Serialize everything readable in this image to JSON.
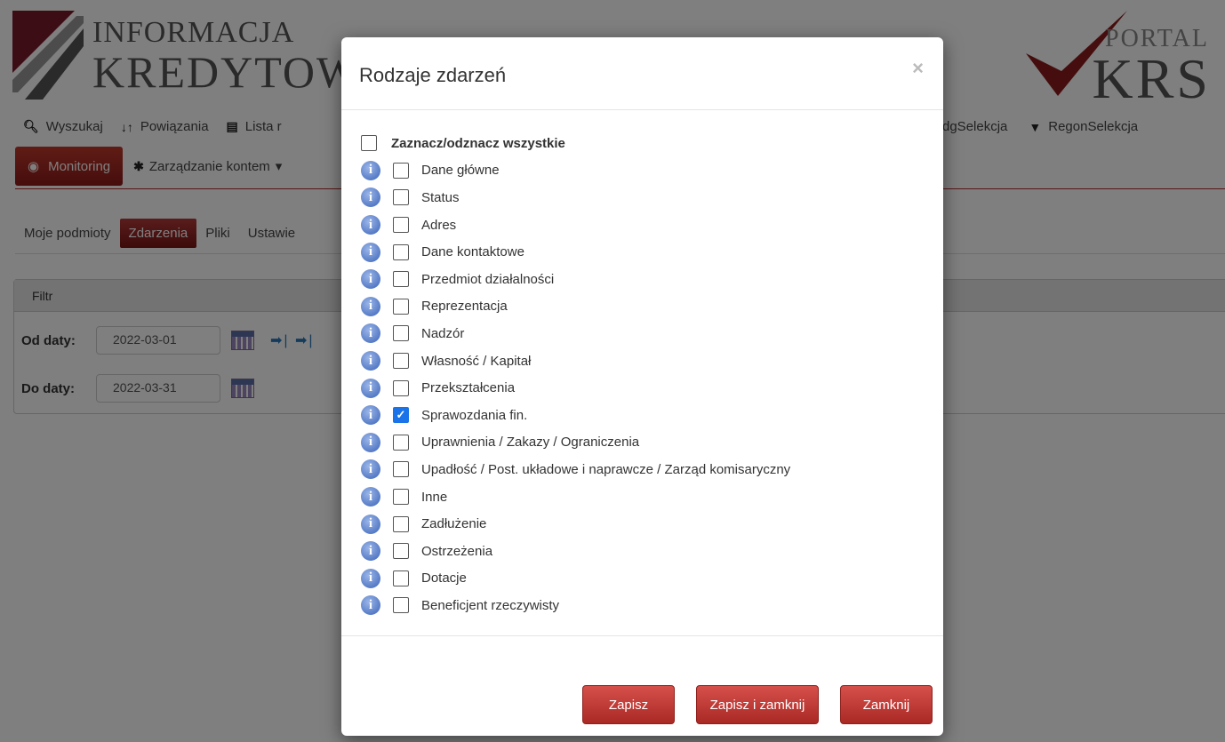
{
  "logo_left": {
    "line1": "INFORMACJA",
    "line2": "KREDYTOWA"
  },
  "logo_right": {
    "line1": "PORTAL",
    "line2": "KRS"
  },
  "nav": {
    "search": "Wyszukaj",
    "relations": "Powiązania",
    "list": "Lista r",
    "ceidg": "dgSelekcja",
    "regon": "RegonSelekcja",
    "monitoring": "Monitoring",
    "account": "Zarządzanie kontem"
  },
  "tabs": {
    "subjects": "Moje podmioty",
    "events": "Zdarzenia",
    "files": "Pliki",
    "settings": "Ustawie"
  },
  "filter": {
    "title": "Filtr",
    "from_label": "Od daty:",
    "from_value": "2022-03-01",
    "to_label": "Do daty:",
    "to_value": "2022-03-31"
  },
  "modal": {
    "title": "Rodzaje zdarzeń",
    "close": "×",
    "select_all": "Zaznacz/odznacz wszystkie",
    "items": [
      {
        "label": "Dane główne",
        "checked": false
      },
      {
        "label": "Status",
        "checked": false
      },
      {
        "label": "Adres",
        "checked": false
      },
      {
        "label": "Dane kontaktowe",
        "checked": false
      },
      {
        "label": "Przedmiot działalności",
        "checked": false
      },
      {
        "label": "Reprezentacja",
        "checked": false
      },
      {
        "label": "Nadzór",
        "checked": false
      },
      {
        "label": "Własność / Kapitał",
        "checked": false
      },
      {
        "label": "Przekształcenia",
        "checked": false
      },
      {
        "label": "Sprawozdania fin.",
        "checked": true
      },
      {
        "label": "Uprawnienia / Zakazy / Ograniczenia",
        "checked": false
      },
      {
        "label": "Upadłość / Post. układowe i naprawcze / Zarząd komisaryczny",
        "checked": false
      },
      {
        "label": "Inne",
        "checked": false
      },
      {
        "label": "Zadłużenie",
        "checked": false
      },
      {
        "label": "Ostrzeżenia",
        "checked": false
      },
      {
        "label": "Dotacje",
        "checked": false
      },
      {
        "label": "Beneficjent rzeczywisty",
        "checked": false
      }
    ],
    "buttons": {
      "save": "Zapisz",
      "save_close": "Zapisz i zamknij",
      "close": "Zamknij"
    }
  },
  "colors": {
    "brand_red": "#a92925",
    "checkbox_checked": "#1a73e8",
    "info_icon": "#3a63b8"
  }
}
